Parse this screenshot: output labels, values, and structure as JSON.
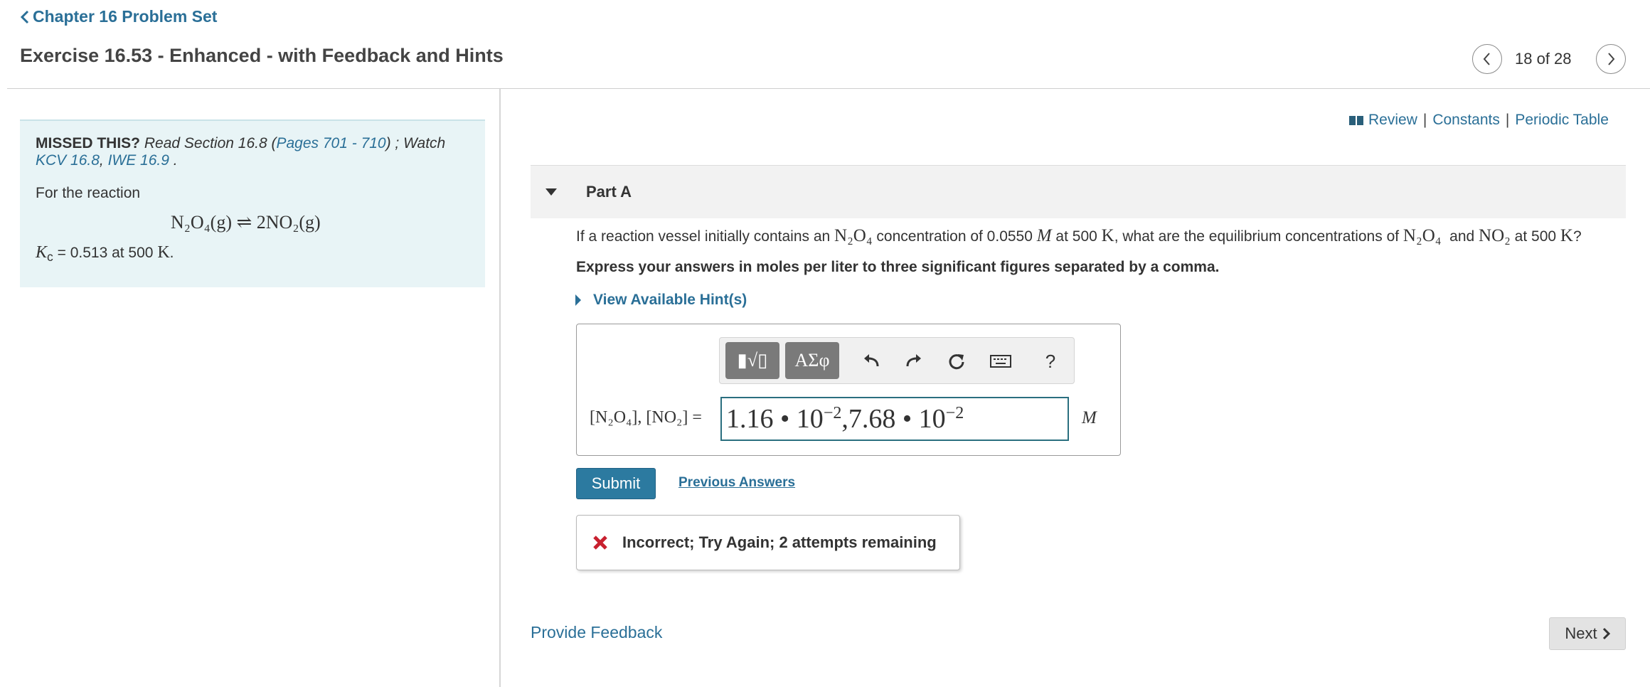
{
  "header": {
    "back_link": "Chapter 16 Problem Set",
    "title": "Exercise 16.53 - Enhanced - with Feedback and Hints",
    "page_counter": "18 of 28"
  },
  "info_panel": {
    "missed_label": "MISSED THIS?",
    "read_text": "Read Section 16.8 (",
    "pages_link": "Pages 701 - 710",
    "watch_text": ") ; Watch",
    "kcv_link": "KCV 16.8",
    "comma": ", ",
    "iwe_link": "IWE 16.9",
    "period": " .",
    "reaction_intro": "For the reaction",
    "reaction_equation": "N₂O₄(g) ⇌ 2NO₂(g)",
    "kc_symbol": "K",
    "kc_sub": "c",
    "kc_rest": " = 0.513 at 500 ",
    "kc_unit": "K",
    "kc_end": "."
  },
  "resources": {
    "review": "Review",
    "constants": "Constants",
    "periodic_table": "Periodic Table",
    "separator": "|"
  },
  "part": {
    "label": "Part A",
    "question_pre": "If a reaction vessel initially contains an ",
    "question_species1": "N₂O₄",
    "question_mid1": " concentration of 0.0550 ",
    "question_M": "M",
    "question_mid2": " at 500 ",
    "question_K": "K",
    "question_mid3": ", what are the equilibrium concentrations of ",
    "question_species2": "N₂O₄",
    "question_and": "  and ",
    "question_species3": "NO₂",
    "question_mid4": " at 500 ",
    "question_K2": "K",
    "question_end": "?",
    "instruction": "Express your answers in moles per liter to three significant figures separated by a comma.",
    "hint_toggle": "View Available Hint(s)"
  },
  "answer": {
    "templates_label": "▮√▯",
    "symbols_label": "ΑΣφ",
    "help_label": "?",
    "label": "[N₂O₄], [NO₂] =",
    "value_a": "1.16 • 10",
    "exp_a": "−2",
    "value_sep": ",",
    "value_b": "7.68 • 10",
    "exp_b": "−2",
    "unit": "M"
  },
  "actions": {
    "submit": "Submit",
    "previous_answers": "Previous Answers"
  },
  "feedback": {
    "message": "Incorrect; Try Again; 2 attempts remaining"
  },
  "footer": {
    "provide_feedback": "Provide Feedback",
    "next": "Next"
  },
  "colors": {
    "link": "#2a6f97",
    "panel_bg": "#e8f4f6",
    "submit_bg": "#2c7aa0",
    "error_red": "#c8202f"
  },
  "icons": [
    "chevron-left-icon",
    "chevron-right-icon",
    "book-icon",
    "triangle-down-icon",
    "triangle-right-icon",
    "undo-icon",
    "redo-icon",
    "reset-icon",
    "keyboard-icon",
    "x-mark-icon"
  ]
}
